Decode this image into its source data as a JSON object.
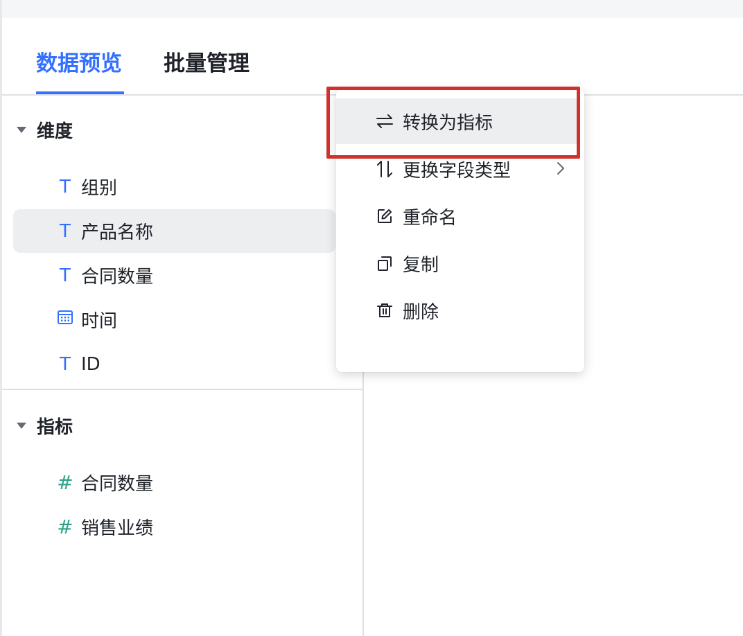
{
  "tabs": [
    {
      "label": "数据预览",
      "active": true
    },
    {
      "label": "批量管理",
      "active": false
    }
  ],
  "dimensions": {
    "title": "维度",
    "fields": [
      {
        "icon": "text-type-icon",
        "glyph": "T",
        "label": "组别"
      },
      {
        "icon": "text-type-icon",
        "glyph": "T",
        "label": "产品名称"
      },
      {
        "icon": "text-type-icon",
        "glyph": "T",
        "label": "合同数量"
      },
      {
        "icon": "calendar-icon",
        "glyph": "",
        "label": "时间"
      },
      {
        "icon": "text-type-icon",
        "glyph": "T",
        "label": "ID"
      }
    ]
  },
  "metrics": {
    "title": "指标",
    "fields": [
      {
        "icon": "number-type-icon",
        "glyph": "#",
        "label": "合同数量"
      },
      {
        "icon": "number-type-icon",
        "glyph": "#",
        "label": "销售业绩"
      }
    ]
  },
  "context_menu": {
    "items": [
      {
        "icon": "swap-icon",
        "label": "转换为指标"
      },
      {
        "icon": "sort-arrows-icon",
        "label": "更换字段类型"
      },
      {
        "icon": "edit-icon",
        "label": "重命名"
      },
      {
        "icon": "copy-icon",
        "label": "复制"
      },
      {
        "icon": "trash-icon",
        "label": "删除"
      }
    ]
  },
  "colors": {
    "accent": "#3370ff",
    "number_icon": "#2ea38a",
    "highlight_box": "#d0312d"
  }
}
